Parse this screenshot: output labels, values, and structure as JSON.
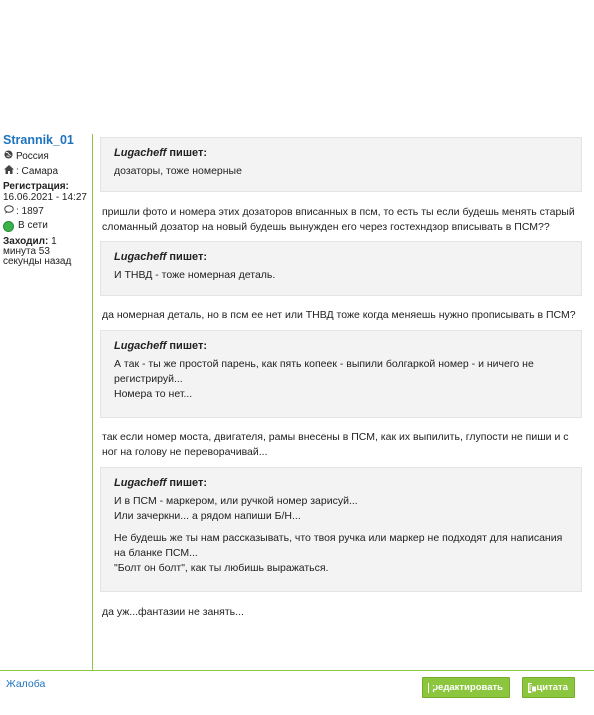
{
  "user": {
    "name": "Strannik_01",
    "country": "Россия",
    "city_label": ": Самара",
    "registration_label": "Регистрация:",
    "registration_date": "16.06.2021 - 14:27",
    "posts_count": ": 1897",
    "online_status": "В сети",
    "last_visit_label": "Заходил:",
    "last_visit_value": " 1",
    "last_visit_rest": "минута 53 секунды назад"
  },
  "post": {
    "quotes": [
      {
        "author": "Lugacheff",
        "writes": " пишет:",
        "paragraphs": [
          "дозаторы, тоже номерные"
        ]
      },
      {
        "author": "Lugacheff",
        "writes": " пишет:",
        "paragraphs": [
          "И ТНВД - тоже номерная деталь."
        ]
      },
      {
        "author": "Lugacheff",
        "writes": " пишет:",
        "paragraphs": [
          "А так - ты же простой парень, как пять копеек - выпили болгаркой номер - и ничего не регистрируй...",
          "Номера то нет..."
        ]
      },
      {
        "author": "Lugacheff",
        "writes": " пишет:",
        "paragraphs": [
          "И в ПСМ - маркером, или ручкой номер зарисуй...",
          "Или зачеркни... а рядом напиши Б/Н...",
          "Не будешь же ты нам рассказывать, что твоя ручка или маркер не подходят для написания на бланке ПСМ...",
          "\"Болт он болт\", как ты любишь выражаться."
        ]
      }
    ],
    "replies": [
      "пришли фото и номера этих дозаторов вписанных в псм, то есть ты если будешь менять старый сломанный дозатор на новый будешь вынужден его через гостехндзор вписывать в ПСМ??",
      "да номерная деталь, но в псм ее нет или ТНВД тоже когда меняешь нужно прописывать в ПСМ?",
      "так если номер моста, двигателя, рамы внесены в ПСМ, как их выпилить, глупости не пиши и с ног на голову не переворачивай...",
      "да уж...фантазии не занять..."
    ]
  },
  "footer": {
    "complaint": "Жалоба",
    "edit_button": "редактировать",
    "quote_button": "цитата"
  },
  "colors": {
    "accent": "#8cc63f",
    "link": "#1e73be",
    "quote_bg": "#f3f3f3",
    "online": "#3cb34a"
  }
}
